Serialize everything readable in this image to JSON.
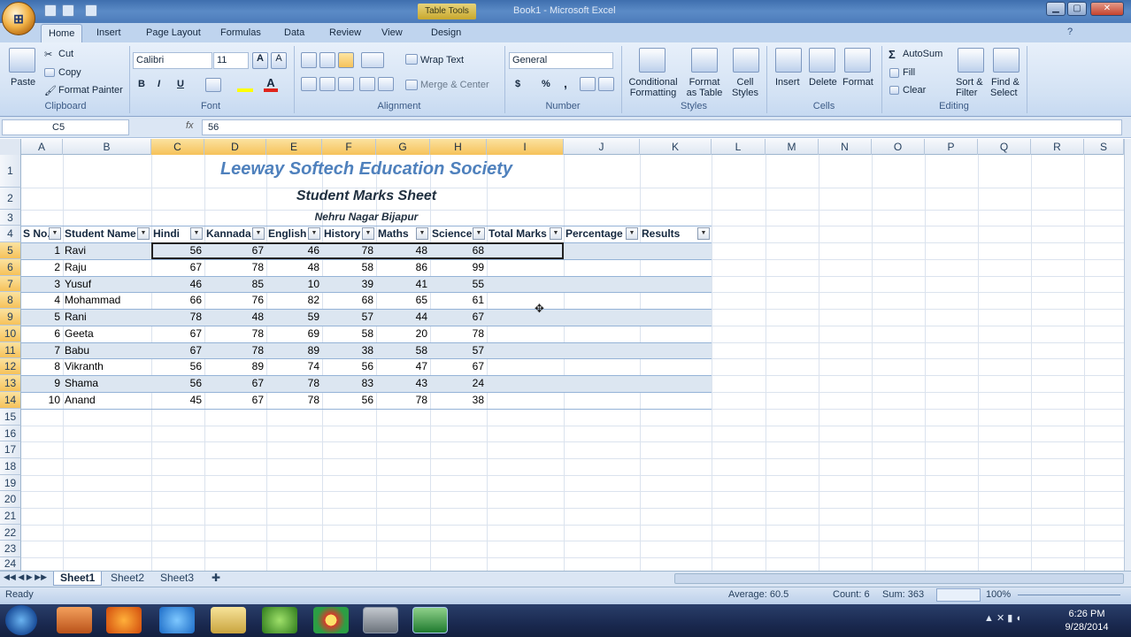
{
  "window": {
    "title": "Book1 - Microsoft Excel",
    "context_tab": "Table Tools"
  },
  "ribbon": {
    "tabs": [
      "Home",
      "Insert",
      "Page Layout",
      "Formulas",
      "Data",
      "Review",
      "View",
      "Design"
    ],
    "active_tab": "Home",
    "clipboard": {
      "paste": "Paste",
      "cut": "Cut",
      "copy": "Copy",
      "format_painter": "Format Painter",
      "label": "Clipboard"
    },
    "font": {
      "name": "Calibri",
      "size": "11",
      "label": "Font",
      "bold": "B",
      "italic": "I",
      "underline": "U"
    },
    "alignment": {
      "wrap_text": "Wrap Text",
      "merge_center": "Merge & Center",
      "label": "Alignment"
    },
    "number": {
      "format": "General",
      "label": "Number",
      "currency": "$",
      "percent": "%",
      "comma": ","
    },
    "styles": {
      "conditional_formatting_1": "Conditional",
      "conditional_formatting_2": "Formatting",
      "format_table_1": "Format",
      "format_table_2": "as Table",
      "cell_styles_1": "Cell",
      "cell_styles_2": "Styles",
      "label": "Styles"
    },
    "cells": {
      "insert": "Insert",
      "delete": "Delete",
      "format": "Format",
      "label": "Cells"
    },
    "editing": {
      "autosum": "AutoSum",
      "fill": "Fill",
      "clear": "Clear",
      "sort_filter_1": "Sort &",
      "sort_filter_2": "Filter",
      "find_select_1": "Find &",
      "find_select_2": "Select",
      "label": "Editing"
    }
  },
  "formula_bar": {
    "name_box": "C5",
    "fx": "fx",
    "value": "56"
  },
  "columns": [
    "A",
    "B",
    "C",
    "D",
    "E",
    "F",
    "G",
    "H",
    "I",
    "J",
    "K",
    "L",
    "M",
    "N",
    "O",
    "P",
    "Q",
    "R",
    "S"
  ],
  "rows": [
    "1",
    "2",
    "3",
    "4",
    "5",
    "6",
    "7",
    "8",
    "9",
    "10",
    "11",
    "12",
    "13",
    "14",
    "15",
    "16",
    "17",
    "18",
    "19",
    "20",
    "21",
    "22",
    "23",
    "24"
  ],
  "sheet": {
    "title": "Leeway Softech Education Society",
    "subtitle": "Student Marks Sheet",
    "location": "Nehru Nagar Bijapur",
    "headers": [
      "S No.",
      "Student Name",
      "Hindi",
      "Kannada",
      "English",
      "History",
      "Maths",
      "Science",
      "Total Marks",
      "Percentage",
      "Results"
    ],
    "records": [
      [
        "1",
        "Ravi",
        "56",
        "67",
        "46",
        "78",
        "48",
        "68"
      ],
      [
        "2",
        "Raju",
        "67",
        "78",
        "48",
        "58",
        "86",
        "99"
      ],
      [
        "3",
        "Yusuf",
        "46",
        "85",
        "10",
        "39",
        "41",
        "55"
      ],
      [
        "4",
        "Mohammad",
        "66",
        "76",
        "82",
        "68",
        "65",
        "61"
      ],
      [
        "5",
        "Rani",
        "78",
        "48",
        "59",
        "57",
        "44",
        "67"
      ],
      [
        "6",
        "Geeta",
        "67",
        "78",
        "69",
        "58",
        "20",
        "78"
      ],
      [
        "7",
        "Babu",
        "67",
        "78",
        "89",
        "38",
        "58",
        "57"
      ],
      [
        "8",
        "Vikranth",
        "56",
        "89",
        "74",
        "56",
        "47",
        "67"
      ],
      [
        "9",
        "Shama",
        "56",
        "67",
        "78",
        "83",
        "43",
        "24"
      ],
      [
        "10",
        "Anand",
        "45",
        "67",
        "78",
        "56",
        "78",
        "38"
      ]
    ]
  },
  "sheet_tabs": [
    "Sheet1",
    "Sheet2",
    "Sheet3"
  ],
  "active_sheet": "Sheet1",
  "status_bar": {
    "mode": "Ready",
    "average": "Average: 60.5",
    "count": "Count: 6",
    "sum": "Sum: 363",
    "zoom": "100%"
  },
  "taskbar": {
    "time": "6:26 PM",
    "date": "9/28/2014"
  },
  "colors": {
    "accent": "#4f81bd",
    "band": "#dce6f1",
    "selected_header": "#f6c25a"
  }
}
